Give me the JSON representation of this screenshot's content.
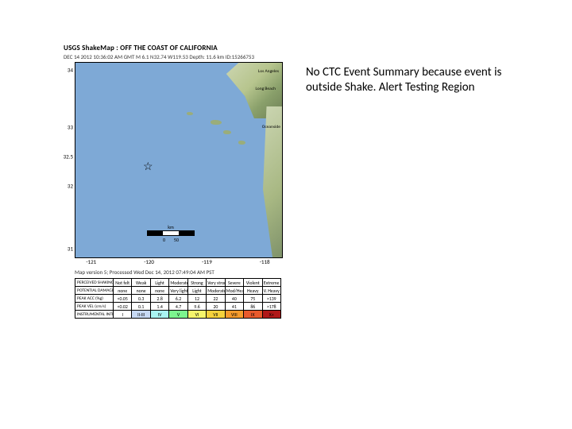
{
  "map": {
    "title": "USGS ShakeMap : OFF THE COAST OF CALIFORNIA",
    "subtitle": "DEC 14 2012 10:36:02 AM GMT   M 6.1   N32.74 W119.53   Depth: 11.6 km   ID:15266753",
    "caption": "Map version 5; Processed Wed Dec 14, 2012 07:49:04 AM PST",
    "lat_ticks": [
      "34",
      "33",
      "32.5",
      "32",
      "31"
    ],
    "lon_ticks": [
      "-121",
      "-120",
      "-119",
      "-118"
    ],
    "city_labels": [
      "Los Angeles",
      "Long Beach",
      "Oceanside"
    ],
    "star_label": "epicenter",
    "scale_label": "km",
    "scale_vals": [
      "0",
      "50"
    ]
  },
  "legend": {
    "rows": [
      {
        "hdr": "PERCEIVED SHAKING",
        "cells": [
          "Not felt",
          "Weak",
          "Light",
          "Moderate",
          "Strong",
          "Very strong",
          "Severe",
          "Violent",
          "Extreme"
        ]
      },
      {
        "hdr": "POTENTIAL DAMAGE",
        "cells": [
          "none",
          "none",
          "none",
          "Very light",
          "Light",
          "Moderate",
          "Mod/Heavy",
          "Heavy",
          "V. Heavy"
        ]
      },
      {
        "hdr": "PEAK ACC (%g)",
        "cells": [
          "<0.05",
          "0.3",
          "2.8",
          "6.2",
          "12",
          "22",
          "40",
          "75",
          ">139"
        ]
      },
      {
        "hdr": "PEAK VEL (cm/s)",
        "cells": [
          "<0.02",
          "0.1",
          "1.4",
          "4.7",
          "9.6",
          "20",
          "41",
          "86",
          ">178"
        ]
      },
      {
        "hdr": "INSTRUMENTAL INTENSITY",
        "cells": [
          "I",
          "II-III",
          "IV",
          "V",
          "VI",
          "VII",
          "VIII",
          "IX",
          "X+"
        ]
      }
    ],
    "intensity_bg": [
      "#ffffff",
      "#c7d9f4",
      "#a9f5f2",
      "#7cf58e",
      "#f5f56b",
      "#f5d23c",
      "#f59b2c",
      "#e85a2c",
      "#b01818"
    ]
  },
  "note": {
    "line1": "No CTC Event Summary because event is",
    "line2": "outside Shake. Alert Testing Region"
  }
}
